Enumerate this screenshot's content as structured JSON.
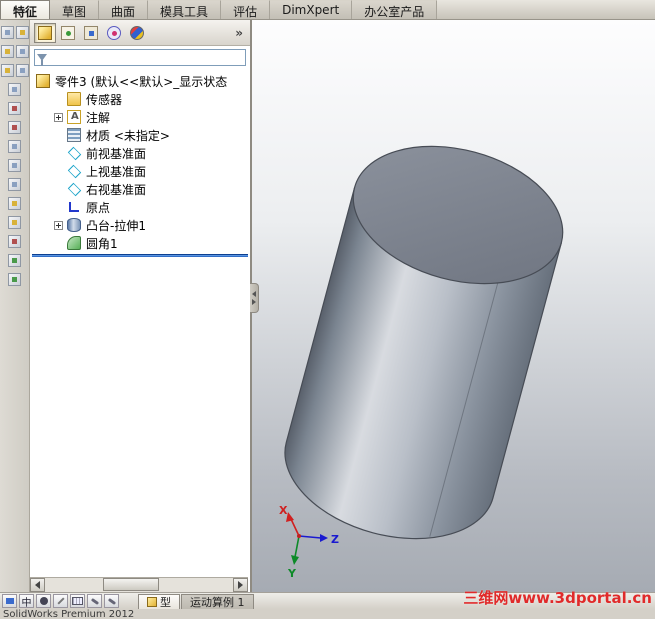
{
  "ribbon_tabs": [
    {
      "label": "特征",
      "active": true
    },
    {
      "label": "草图",
      "active": false
    },
    {
      "label": "曲面",
      "active": false
    },
    {
      "label": "模具工具",
      "active": false
    },
    {
      "label": "评估",
      "active": false
    },
    {
      "label": "DimXpert",
      "active": false
    },
    {
      "label": "办公室产品",
      "active": false
    }
  ],
  "panel": {
    "header_icons": [
      "featuremanager-icon",
      "propertymanager-icon",
      "configurationmanager-icon",
      "dimxpertmanager-icon",
      "displaymanager-icon"
    ],
    "overflow_chevron": "»",
    "filter_value": ""
  },
  "feature_tree": {
    "root": {
      "label": "零件3 (默认<<默认>_显示状态",
      "icon": "part-icon"
    },
    "items": [
      {
        "label": "传感器",
        "icon": "sensors-icon",
        "expandable": false
      },
      {
        "label": "注解",
        "icon": "annotations-icon",
        "expandable": true
      },
      {
        "label": "材质 <未指定>",
        "icon": "material-icon",
        "expandable": false
      },
      {
        "label": "前视基准面",
        "icon": "plane-icon",
        "expandable": false
      },
      {
        "label": "上视基准面",
        "icon": "plane-icon",
        "expandable": false
      },
      {
        "label": "右视基准面",
        "icon": "plane-icon",
        "expandable": false
      },
      {
        "label": "原点",
        "icon": "origin-icon",
        "expandable": false
      },
      {
        "label": "凸台-拉伸1",
        "icon": "extrude-icon",
        "expandable": true
      },
      {
        "label": "圆角1",
        "icon": "fillet-icon",
        "expandable": false
      }
    ]
  },
  "viewport": {
    "triad": {
      "x": "X",
      "y": "Y",
      "z": "Z"
    }
  },
  "status_bar": {
    "ime_chinese": "中",
    "model_tab": "型",
    "motion_tab": "运动算例 1"
  },
  "watermark": "三维网www.3dportal.cn",
  "app_footer": "SolidWorks Premium 2012",
  "colors": {
    "rollback_blue": "#1e5bb8",
    "watermark_red": "#e02a2a",
    "plane_cyan": "#18a3c9"
  }
}
